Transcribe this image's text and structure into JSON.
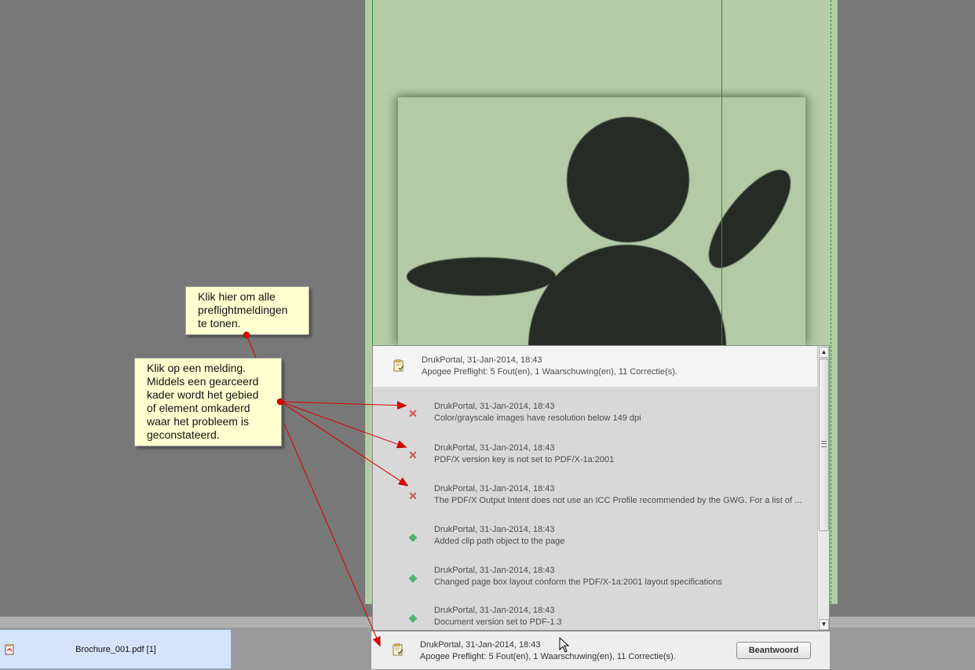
{
  "document": {
    "tab_label": "Brochure_001.pdf [1]"
  },
  "panel": {
    "header": {
      "source": "DrukPortal, 31-Jan-2014, 18:43",
      "summary": "Apogee Preflight: 5 Fout(en), 1 Waarschuwing(en), 11 Correctie(s)."
    },
    "items": [
      {
        "type": "error",
        "source": "DrukPortal, 31-Jan-2014, 18:43",
        "text": "Color/grayscale images have resolution below 149 dpi"
      },
      {
        "type": "error",
        "source": "DrukPortal, 31-Jan-2014, 18:43",
        "text": "PDF/X version key is not set to PDF/X-1a:2001"
      },
      {
        "type": "error",
        "source": "DrukPortal, 31-Jan-2014, 18:43",
        "text": "The PDF/X Output Intent does not use an ICC Profile recommended by the GWG. For a list of ..."
      },
      {
        "type": "correction",
        "source": "DrukPortal, 31-Jan-2014, 18:43",
        "text": "Added clip path object to the page"
      },
      {
        "type": "correction",
        "source": "DrukPortal, 31-Jan-2014, 18:43",
        "text": "Changed page box layout conform the PDF/X-1a:2001 layout specifications"
      },
      {
        "type": "correction",
        "source": "DrukPortal, 31-Jan-2014, 18:43",
        "text": "Document version set to PDF-1.3"
      }
    ]
  },
  "notification_bar": {
    "source": "DrukPortal, 31-Jan-2014, 18:43",
    "summary": "Apogee Preflight: 5 Fout(en), 1 Waarschuwing(en), 11 Correctie(s).",
    "reply_label": "Beantwoord"
  },
  "notes": {
    "top": [
      "Klik hier om alle",
      "preflightmeldingen",
      "te tonen."
    ],
    "main": [
      "Klik op een melding.",
      "Middels een gearceerd",
      "kader wordt het gebied",
      "of element omkaderd",
      "waar het probleem is",
      "geconstateerd."
    ]
  },
  "icons": {
    "error": "error-x-icon",
    "correction": "correction-diamond-icon",
    "document": "document-check-icon"
  },
  "colors": {
    "error": "#d94a4a",
    "correction": "#4db56a",
    "page": "#b4cca8",
    "annotation": "#e00000"
  }
}
